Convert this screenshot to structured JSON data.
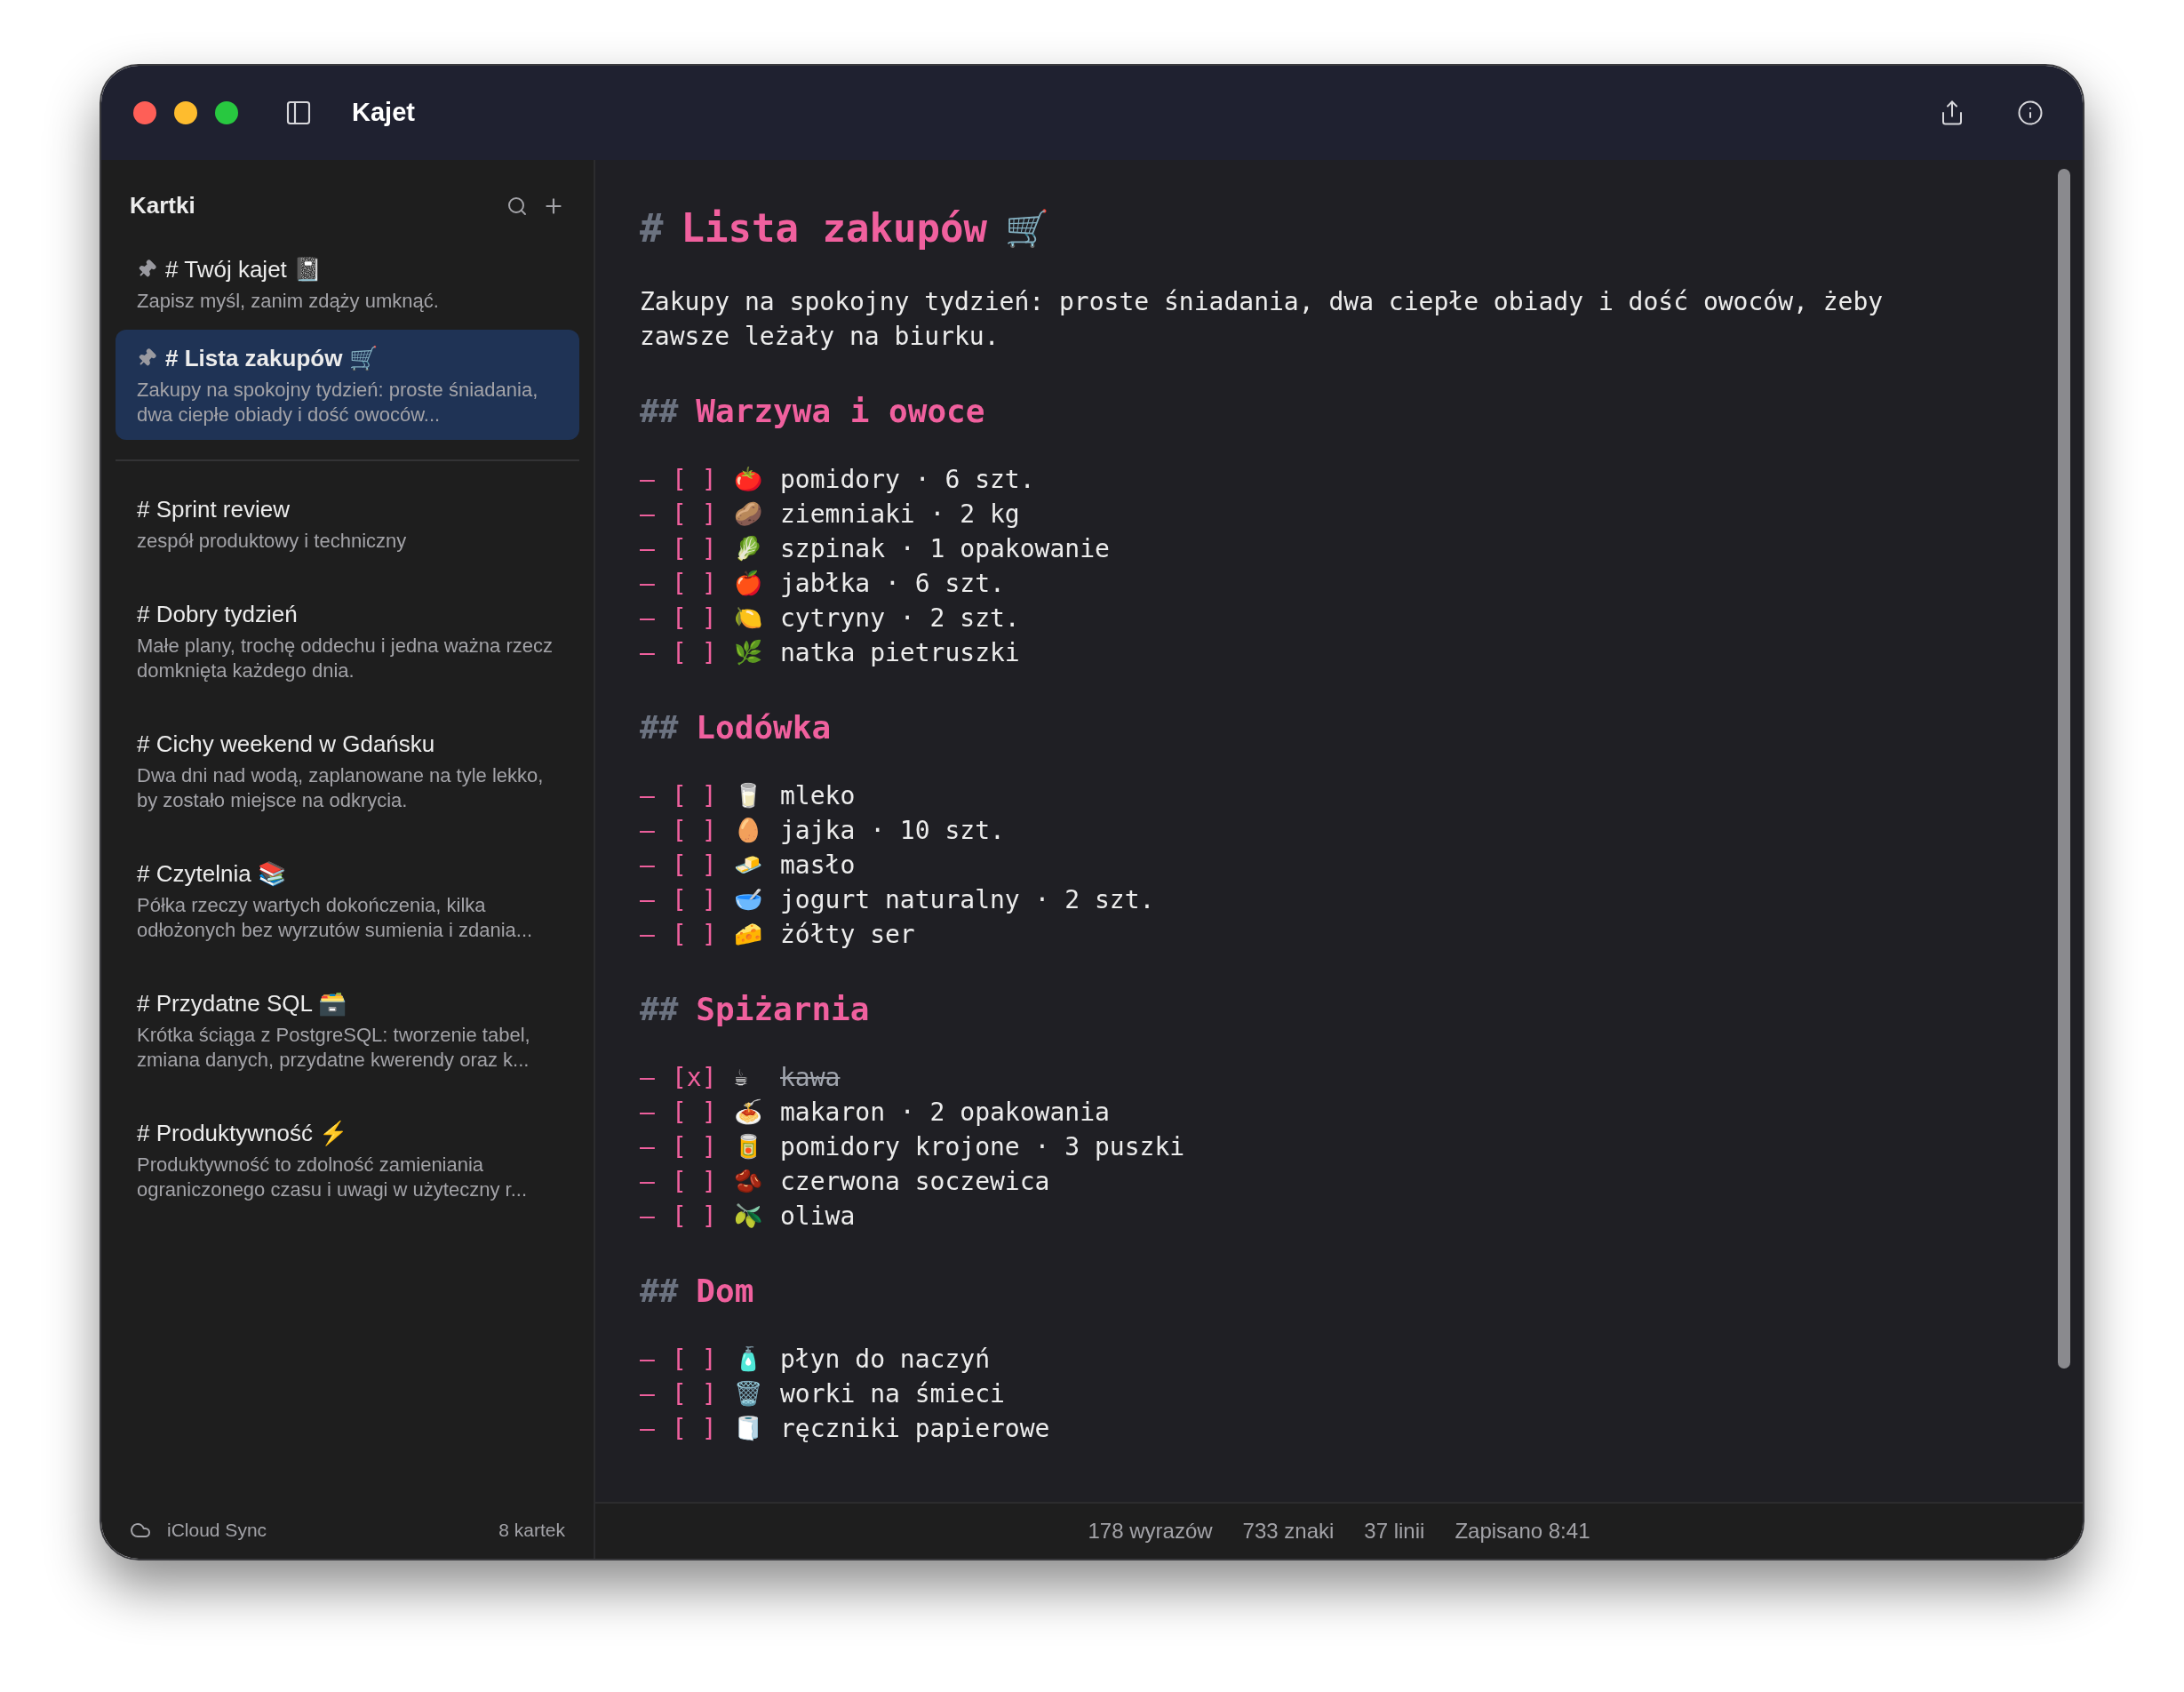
{
  "window": {
    "title": "Kajet"
  },
  "sidebar": {
    "title": "Kartki",
    "notes": [
      {
        "title": "# Twój kajet 📓",
        "preview": "Zapisz myśl, zanim zdąży umknąć.",
        "pinned": true,
        "selected": false
      },
      {
        "title": "# Lista zakupów 🛒",
        "preview": "Zakupy na spokojny tydzień: proste śniadania, dwa ciepłe obiady i dość owoców...",
        "pinned": true,
        "selected": true
      },
      {
        "title": "# Sprint review",
        "preview": "zespół produktowy i techniczny",
        "pinned": false,
        "selected": false
      },
      {
        "title": "# Dobry tydzień",
        "preview": "Małe plany, trochę oddechu i jedna ważna rzecz domknięta każdego dnia.",
        "pinned": false,
        "selected": false
      },
      {
        "title": "# Cichy weekend w Gdańsku",
        "preview": "Dwa dni nad wodą, zaplanowane na tyle lekko, by zostało miejsce na odkrycia.",
        "pinned": false,
        "selected": false
      },
      {
        "title": "# Czytelnia 📚",
        "preview": "Półka rzeczy wartych dokończenia, kilka odłożonych bez wyrzutów sumienia i zdania...",
        "pinned": false,
        "selected": false
      },
      {
        "title": "# Przydatne SQL 🗃️",
        "preview": "Krótka ściąga z PostgreSQL: tworzenie tabel, zmiana danych, przydatne kwerendy oraz k...",
        "pinned": false,
        "selected": false
      },
      {
        "title": "# Produktywność ⚡",
        "preview": "Produktywność to zdolność zamieniania ograniczonego czasu i uwagi w użyteczny r...",
        "pinned": false,
        "selected": false
      }
    ],
    "footer": {
      "sync": "iCloud Sync",
      "count": "8 kartek"
    }
  },
  "editor": {
    "title": {
      "marker": "#",
      "text": "Lista zakupów",
      "emoji": "🛒"
    },
    "intro": "Zakupy na spokojny tydzień: proste śniadania, dwa ciepłe obiady i dość owoców, żeby zawsze leżały na biurku.",
    "sections": [
      {
        "marker": "##",
        "heading": "Warzywa i owoce",
        "items": [
          {
            "bullet": "–",
            "box": "[ ]",
            "checked": false,
            "emoji": "🍅",
            "text": "pomidory · 6 szt."
          },
          {
            "bullet": "–",
            "box": "[ ]",
            "checked": false,
            "emoji": "🥔",
            "text": "ziemniaki · 2 kg"
          },
          {
            "bullet": "–",
            "box": "[ ]",
            "checked": false,
            "emoji": "🥬",
            "text": "szpinak · 1 opakowanie"
          },
          {
            "bullet": "–",
            "box": "[ ]",
            "checked": false,
            "emoji": "🍎",
            "text": "jabłka · 6 szt."
          },
          {
            "bullet": "–",
            "box": "[ ]",
            "checked": false,
            "emoji": "🍋",
            "text": "cytryny · 2 szt."
          },
          {
            "bullet": "–",
            "box": "[ ]",
            "checked": false,
            "emoji": "🌿",
            "text": "natka pietruszki"
          }
        ]
      },
      {
        "marker": "##",
        "heading": "Lodówka",
        "items": [
          {
            "bullet": "–",
            "box": "[ ]",
            "checked": false,
            "emoji": "🥛",
            "text": "mleko"
          },
          {
            "bullet": "–",
            "box": "[ ]",
            "checked": false,
            "emoji": "🥚",
            "text": "jajka · 10 szt."
          },
          {
            "bullet": "–",
            "box": "[ ]",
            "checked": false,
            "emoji": "🧈",
            "text": "masło"
          },
          {
            "bullet": "–",
            "box": "[ ]",
            "checked": false,
            "emoji": "🥣",
            "text": "jogurt naturalny · 2 szt."
          },
          {
            "bullet": "–",
            "box": "[ ]",
            "checked": false,
            "emoji": "🧀",
            "text": "żółty ser"
          }
        ]
      },
      {
        "marker": "##",
        "heading": "Spiżarnia",
        "items": [
          {
            "bullet": "–",
            "box": "[x]",
            "checked": true,
            "emoji": "☕",
            "text": "kawa"
          },
          {
            "bullet": "–",
            "box": "[ ]",
            "checked": false,
            "emoji": "🍝",
            "text": "makaron · 2 opakowania"
          },
          {
            "bullet": "–",
            "box": "[ ]",
            "checked": false,
            "emoji": "🥫",
            "text": "pomidory krojone · 3 puszki"
          },
          {
            "bullet": "–",
            "box": "[ ]",
            "checked": false,
            "emoji": "🫘",
            "text": "czerwona soczewica"
          },
          {
            "bullet": "–",
            "box": "[ ]",
            "checked": false,
            "emoji": "🫒",
            "text": "oliwa"
          }
        ]
      },
      {
        "marker": "##",
        "heading": "Dom",
        "items": [
          {
            "bullet": "–",
            "box": "[ ]",
            "checked": false,
            "emoji": "🧴",
            "text": "płyn do naczyń"
          },
          {
            "bullet": "–",
            "box": "[ ]",
            "checked": false,
            "emoji": "🗑️",
            "text": "worki na śmieci"
          },
          {
            "bullet": "–",
            "box": "[ ]",
            "checked": false,
            "emoji": "🧻",
            "text": "ręczniki papierowe"
          }
        ]
      }
    ]
  },
  "status_bar": [
    "178 wyrazów",
    "733 znaki",
    "37 linii",
    "Zapisano 8:41"
  ]
}
